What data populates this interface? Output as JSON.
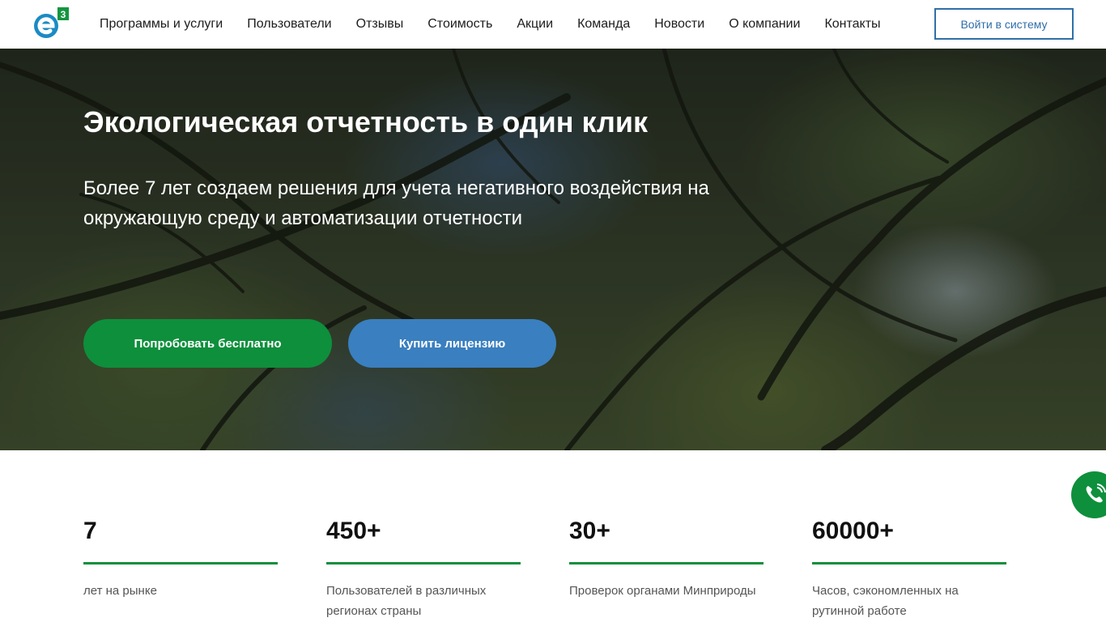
{
  "header": {
    "logo_icon": "e3-logo",
    "nav": [
      {
        "label": "Программы и услуги"
      },
      {
        "label": "Пользователи"
      },
      {
        "label": "Отзывы"
      },
      {
        "label": "Стоимость"
      },
      {
        "label": "Акции"
      },
      {
        "label": "Команда"
      },
      {
        "label": "Новости"
      },
      {
        "label": "О компании"
      },
      {
        "label": "Контакты"
      }
    ],
    "login_label": "Войти в систему"
  },
  "hero": {
    "title": "Экологическая отчетность в один клик",
    "subtitle": "Более 7 лет создаем решения для учета негативного воздействия на окружающую среду и автоматизации отчетности",
    "try_label": "Попробовать бесплатно",
    "buy_label": "Купить лицензию"
  },
  "stats": [
    {
      "value": "7",
      "label": "лет на рынке"
    },
    {
      "value": "450+",
      "label": "Пользователей в различных регионах страны"
    },
    {
      "value": "30+",
      "label": "Проверок органами Минприроды"
    },
    {
      "value": "60000+",
      "label": "Часов, сэкономленных на рутинной работе"
    }
  ],
  "colors": {
    "accent_green": "#0e8f3c",
    "accent_blue": "#3a7fbf",
    "login_border": "#2f6fa8"
  },
  "icons": {
    "phone": "phone-icon"
  }
}
